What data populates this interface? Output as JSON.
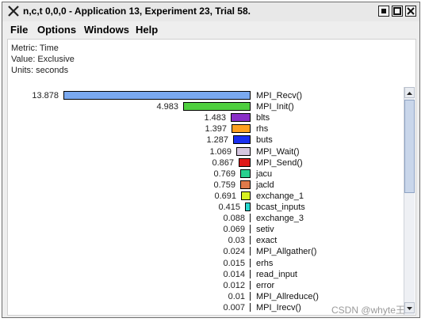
{
  "window": {
    "title": "n,c,t 0,0,0 - Application 13, Experiment 23, Trial 58."
  },
  "menu": {
    "file": "File",
    "options": "Options",
    "windows": "Windows",
    "help": "Help"
  },
  "info": {
    "metric": "Metric: Time",
    "value": "Value: Exclusive",
    "units": "Units: seconds"
  },
  "rows": [
    {
      "value": "13.878",
      "label": "MPI_Recv()",
      "color": "#7aa9f0"
    },
    {
      "value": "4.983",
      "label": "MPI_Init()",
      "color": "#4fcf3f"
    },
    {
      "value": "1.483",
      "label": "blts",
      "color": "#8a30c8"
    },
    {
      "value": "1.397",
      "label": "rhs",
      "color": "#ffa020"
    },
    {
      "value": "1.287",
      "label": "buts",
      "color": "#1a2ff0"
    },
    {
      "value": "1.069",
      "label": "MPI_Wait()",
      "color": "#d6c6e0"
    },
    {
      "value": "0.867",
      "label": "MPI_Send()",
      "color": "#e01818"
    },
    {
      "value": "0.769",
      "label": "jacu",
      "color": "#28d08e"
    },
    {
      "value": "0.759",
      "label": "jacld",
      "color": "#e07a4a"
    },
    {
      "value": "0.691",
      "label": "exchange_1",
      "color": "#d8f020"
    },
    {
      "value": "0.415",
      "label": "bcast_inputs",
      "color": "#28d8d0"
    },
    {
      "value": "0.088",
      "label": "exchange_3",
      "color": "#555555"
    },
    {
      "value": "0.069",
      "label": "setiv",
      "color": "#555555"
    },
    {
      "value": "0.03",
      "label": "exact",
      "color": "#555555"
    },
    {
      "value": "0.024",
      "label": "MPI_Allgather()",
      "color": "#555555"
    },
    {
      "value": "0.015",
      "label": "erhs",
      "color": "#555555"
    },
    {
      "value": "0.014",
      "label": "read_input",
      "color": "#555555"
    },
    {
      "value": "0.012",
      "label": "error",
      "color": "#555555"
    },
    {
      "value": "0.01",
      "label": "MPI_Allreduce()",
      "color": "#555555"
    },
    {
      "value": "0.007",
      "label": "MPI_Irecv()",
      "color": "#555555"
    }
  ],
  "watermark": "CSDN @whyte王",
  "icons": {
    "app": "x-logo-icon",
    "minimize": "minimize-icon",
    "maximize": "maximize-icon",
    "close": "close-icon",
    "scroll_up": "arrow-up-icon",
    "scroll_down": "arrow-down-icon"
  }
}
